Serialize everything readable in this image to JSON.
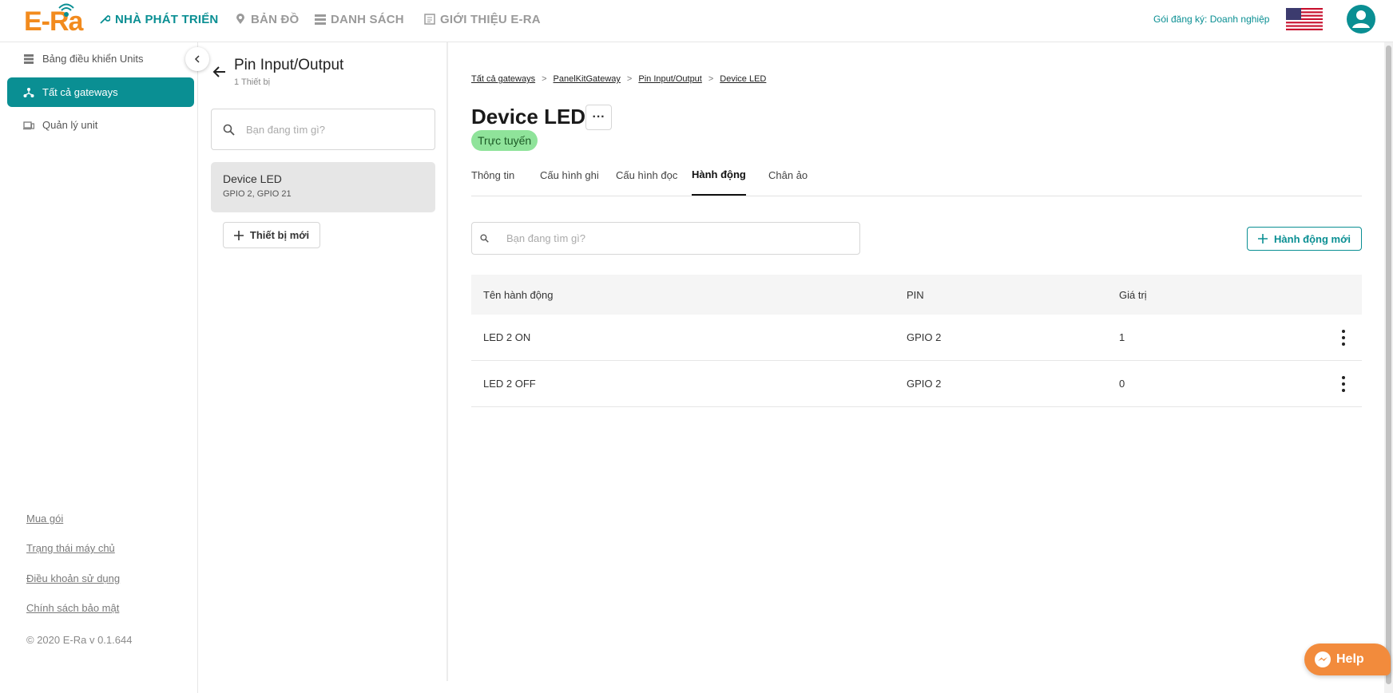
{
  "header": {
    "logo_text": "E-Ra",
    "nav": [
      {
        "label": "NHÀ PHÁT TRIỂN",
        "icon": "wrench-icon",
        "active": true
      },
      {
        "label": "BẢN ĐỒ",
        "icon": "map-pin-icon",
        "active": false
      },
      {
        "label": "DANH SÁCH",
        "icon": "list-icon",
        "active": false
      },
      {
        "label": "GIỚI THIỆU E-RA",
        "icon": "document-icon",
        "active": false
      }
    ],
    "plan_label": "Gói đăng ký: Doanh nghiệp",
    "flag": "us-flag-icon",
    "avatar": "user-avatar-icon"
  },
  "sidebar": {
    "items": [
      {
        "label": "Bảng điều khiển Units",
        "icon": "dashboard-icon",
        "active": false
      },
      {
        "label": "Tất cả gateways",
        "icon": "network-icon",
        "active": true
      },
      {
        "label": "Quản lý unit",
        "icon": "devices-icon",
        "active": false
      }
    ],
    "links": [
      "Mua gói",
      "Trạng thái máy chủ",
      "Điều khoản sử dụng",
      "Chính sách bảo mật"
    ],
    "copyright": "© 2020 E-Ra v 0.1.644"
  },
  "device_panel": {
    "title": "Pin Input/Output",
    "subtitle": "1 Thiết bị",
    "search_placeholder": "Bạn đang tìm gì?",
    "devices": [
      {
        "name": "Device LED",
        "pins": "GPIO 2, GPIO 21"
      }
    ],
    "new_device_label": "Thiết bị mới"
  },
  "main": {
    "breadcrumb": [
      "Tất cả gateways",
      "PanelKitGateway",
      "Pin Input/Output",
      "Device LED"
    ],
    "breadcrumb_separator": ">",
    "title": "Device LED",
    "more_label": "···",
    "status": "Trực tuyến",
    "status_color": "#8fe39a",
    "tabs": [
      "Thông tin",
      "Cấu hình ghi",
      "Cấu hình đọc",
      "Hành động",
      "Chân ảo"
    ],
    "active_tab": "Hành động",
    "search_placeholder": "Bạn đang tìm gì?",
    "new_action_label": "Hành động mới",
    "table": {
      "headers": [
        "Tên hành động",
        "PIN",
        "Giá trị"
      ],
      "rows": [
        {
          "name": "LED 2 ON",
          "pin": "GPIO 2",
          "value": "1"
        },
        {
          "name": "LED 2 OFF",
          "pin": "GPIO 2",
          "value": "0"
        }
      ]
    }
  },
  "help": {
    "label": "Help",
    "icon": "messenger-icon"
  },
  "colors": {
    "accent": "#0a8f93",
    "brand_orange": "#f28b1e",
    "help_orange": "#f28b3c"
  }
}
